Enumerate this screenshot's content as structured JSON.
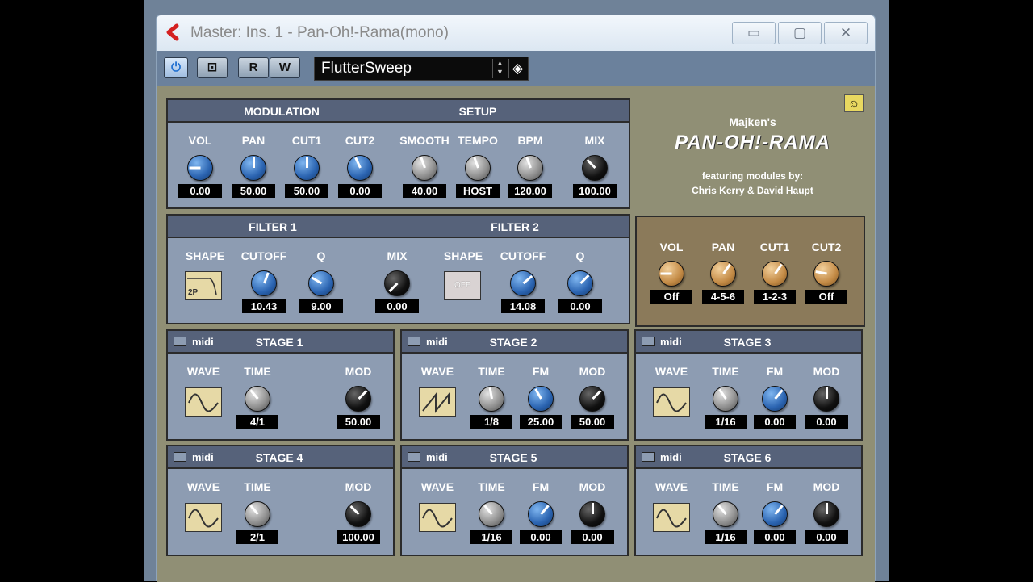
{
  "window": {
    "title": "Master: Ins. 1 - Pan-Oh!-Rama(mono)",
    "minimize": "▭",
    "maximize": "▢",
    "close": "✕"
  },
  "toolbar": {
    "power": "⏻",
    "bypass": "⊡",
    "read": "R",
    "write": "W",
    "preset": "FlutterSweep"
  },
  "brand": {
    "author": "Majken's",
    "name": "PAN-OH!-RAMA",
    "featuring": "featuring modules by:",
    "credits": "Chris Kerry & David Haupt"
  },
  "modulation": {
    "header_left": "MODULATION",
    "header_right": "SETUP",
    "knobs": [
      {
        "label": "VOL",
        "value": "0.00",
        "color": "blue"
      },
      {
        "label": "PAN",
        "value": "50.00",
        "color": "blue"
      },
      {
        "label": "CUT1",
        "value": "50.00",
        "color": "blue"
      },
      {
        "label": "CUT2",
        "value": "0.00",
        "color": "blue"
      },
      {
        "label": "SMOOTH",
        "value": "40.00",
        "color": "gray"
      },
      {
        "label": "TEMPO",
        "value": "HOST",
        "color": "gray"
      },
      {
        "label": "BPM",
        "value": "120.00",
        "color": "gray"
      },
      {
        "label": "MIX",
        "value": "100.00",
        "color": "black"
      }
    ]
  },
  "filters": {
    "header_1": "FILTER 1",
    "header_2": "FILTER 2",
    "f1": {
      "shape_label": "SHAPE",
      "shape_value": "2P",
      "cutoff_label": "CUTOFF",
      "cutoff": "10.43",
      "q_label": "Q",
      "q": "9.00"
    },
    "mix": {
      "label": "MIX",
      "value": "0.00"
    },
    "f2": {
      "shape_label": "SHAPE",
      "shape_value": "OFF",
      "cutoff_label": "CUTOFF",
      "cutoff": "14.08",
      "q_label": "Q",
      "q": "0.00"
    }
  },
  "routing": {
    "knobs": [
      {
        "label": "VOL",
        "value": "Off"
      },
      {
        "label": "PAN",
        "value": "4-5-6"
      },
      {
        "label": "CUT1",
        "value": "1-2-3"
      },
      {
        "label": "CUT2",
        "value": "Off"
      }
    ]
  },
  "stages": [
    {
      "title": "STAGE 1",
      "midi": "midi",
      "wave_label": "WAVE",
      "wave": "sine",
      "time_label": "TIME",
      "time": "4/1",
      "fm_label": "",
      "fm": "",
      "mod_label": "MOD",
      "mod": "50.00"
    },
    {
      "title": "STAGE 2",
      "midi": "midi",
      "wave_label": "WAVE",
      "wave": "saw",
      "time_label": "TIME",
      "time": "1/8",
      "fm_label": "FM",
      "fm": "25.00",
      "mod_label": "MOD",
      "mod": "50.00"
    },
    {
      "title": "STAGE 3",
      "midi": "midi",
      "wave_label": "WAVE",
      "wave": "sine",
      "time_label": "TIME",
      "time": "1/16",
      "fm_label": "FM",
      "fm": "0.00",
      "mod_label": "MOD",
      "mod": "0.00"
    },
    {
      "title": "STAGE 4",
      "midi": "midi",
      "wave_label": "WAVE",
      "wave": "sine",
      "time_label": "TIME",
      "time": "2/1",
      "fm_label": "",
      "fm": "",
      "mod_label": "MOD",
      "mod": "100.00"
    },
    {
      "title": "STAGE 5",
      "midi": "midi",
      "wave_label": "WAVE",
      "wave": "sine",
      "time_label": "TIME",
      "time": "1/16",
      "fm_label": "FM",
      "fm": "0.00",
      "mod_label": "MOD",
      "mod": "0.00"
    },
    {
      "title": "STAGE 6",
      "midi": "midi",
      "wave_label": "WAVE",
      "wave": "sine",
      "time_label": "TIME",
      "time": "1/16",
      "fm_label": "FM",
      "fm": "0.00",
      "mod_label": "MOD",
      "mod": "0.00"
    }
  ]
}
